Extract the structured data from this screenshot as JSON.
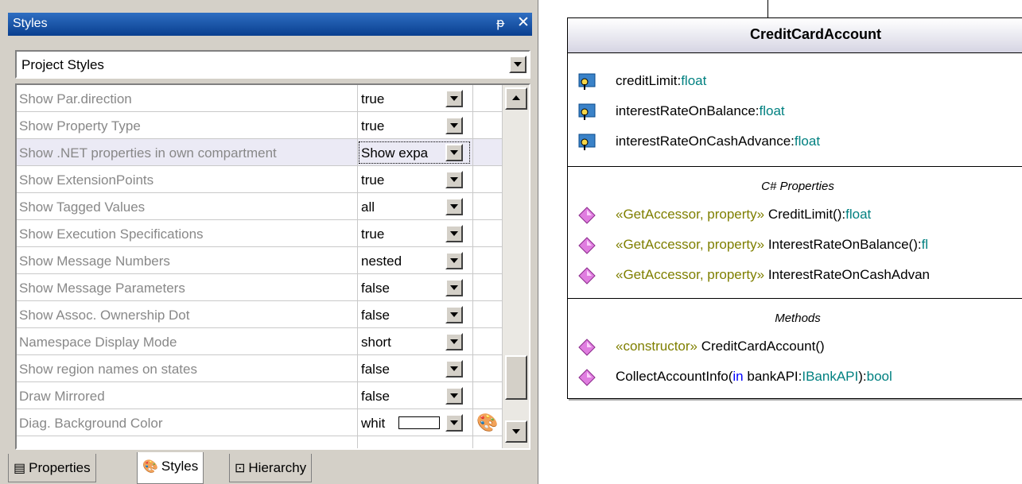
{
  "panel": {
    "title": "Styles",
    "pin_icon": "ᵽ",
    "close_icon": "✕",
    "combo_value": "Project Styles",
    "rows": [
      {
        "name": "Show Par.direction",
        "value": "true"
      },
      {
        "name": "Show Property Type",
        "value": "true"
      },
      {
        "name": "Show .NET properties in own compartment",
        "value": "Show expa"
      },
      {
        "name": "Show ExtensionPoints",
        "value": "true"
      },
      {
        "name": "Show Tagged Values",
        "value": "all"
      },
      {
        "name": "Show Execution Specifications",
        "value": "true"
      },
      {
        "name": "Show Message Numbers",
        "value": "nested"
      },
      {
        "name": "Show Message Parameters",
        "value": "false"
      },
      {
        "name": "Show Assoc. Ownership Dot",
        "value": "false"
      },
      {
        "name": "Namespace Display Mode",
        "value": "short"
      },
      {
        "name": "Show region names on states",
        "value": "false"
      },
      {
        "name": "Draw Mirrored",
        "value": "false"
      },
      {
        "name": "Diag. Background Color",
        "value": "whit"
      }
    ],
    "tabs": [
      {
        "label": "Properties"
      },
      {
        "label": "Styles"
      },
      {
        "label": "Hierarchy"
      }
    ]
  },
  "class": {
    "name": "CreditCardAccount",
    "attributes": [
      {
        "name": "creditLimit:",
        "type": "float"
      },
      {
        "name": "interestRateOnBalance:",
        "type": "float"
      },
      {
        "name": "interestRateOnCashAdvance:",
        "type": "float"
      }
    ],
    "properties_title": "C# Properties",
    "properties": [
      {
        "stereotype": "«GetAccessor, property»",
        "name": " CreditLimit():",
        "type": "float"
      },
      {
        "stereotype": "«GetAccessor, property»",
        "name": " InterestRateOnBalance():",
        "type": "fl"
      },
      {
        "stereotype": "«GetAccessor, property»",
        "name": " InterestRateOnCashAdvan",
        "type": ""
      }
    ],
    "methods_title": "Methods",
    "methods": [
      {
        "stereotype": "«constructor»",
        "name": " CreditCardAccount()"
      },
      {
        "pre": "CollectAccountInfo(",
        "kw": "in",
        "mid": " bankAPI:",
        "type": "IBankAPI",
        "post": "):",
        "ret": "bool"
      }
    ]
  }
}
